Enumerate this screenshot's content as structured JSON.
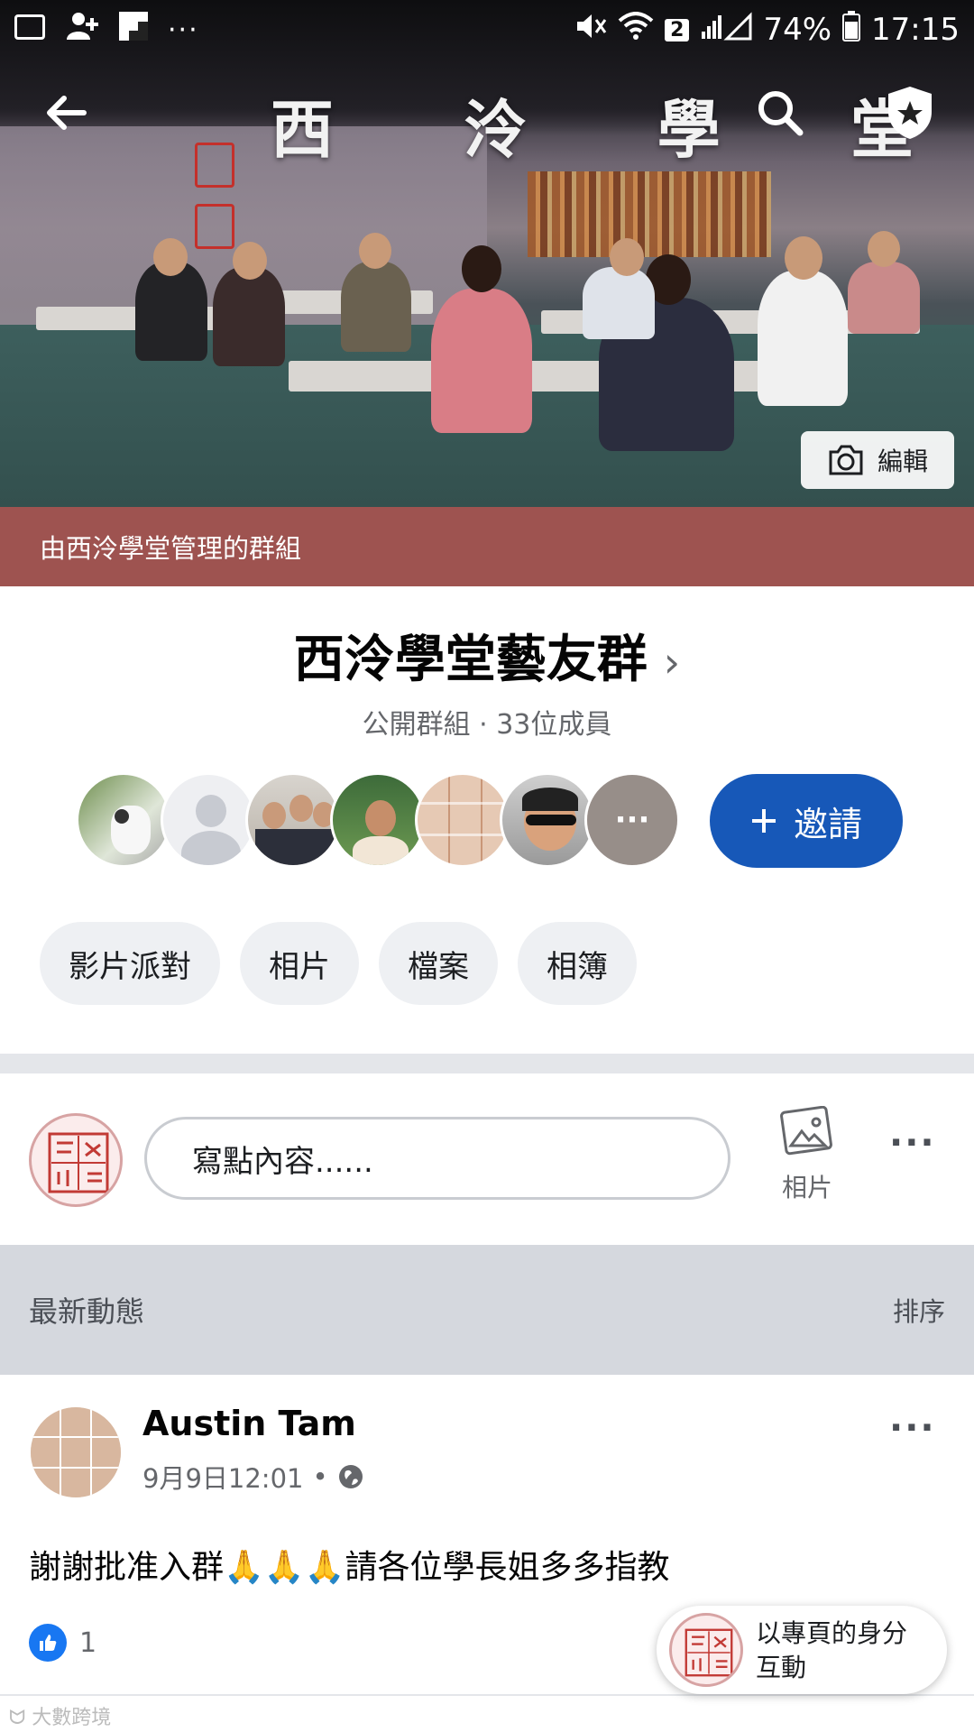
{
  "status_bar": {
    "battery": "74%",
    "time": "17:15",
    "sim_badge": "2",
    "icons": [
      "screen-cast-icon",
      "add-person-icon",
      "flipboard-icon",
      "more-icon",
      "mute-icon",
      "wifi-icon",
      "signal-icon",
      "battery-icon"
    ]
  },
  "cover": {
    "calligraphy": "西 泠 學 堂",
    "edit_label": "編輯",
    "admin_text": "由西泠學堂管理的群組"
  },
  "group": {
    "name": "西泠學堂藝友群",
    "meta": "公開群組 · 33位成員",
    "invite_label": "邀請",
    "more_members": "···"
  },
  "tabs": [
    "影片派對",
    "相片",
    "檔案",
    "相簿"
  ],
  "composer": {
    "placeholder": "寫點內容......",
    "photo_label": "相片"
  },
  "feed": {
    "header": "最新動態",
    "sort_label": "排序"
  },
  "post": {
    "author": "Austin Tam",
    "time": "9月9日12:01",
    "dot": "•",
    "text": "謝謝批准入群🙏🙏🙏請各位學長姐多多指教",
    "like_count": "1"
  },
  "page_toggle": {
    "label_line1": "以專頁的身分",
    "label_line2": "互動"
  },
  "watermark": "大數跨境",
  "colors": {
    "admin_bar": "#9e5350",
    "invite_button": "#1758b8",
    "like_badge": "#1877f2"
  }
}
